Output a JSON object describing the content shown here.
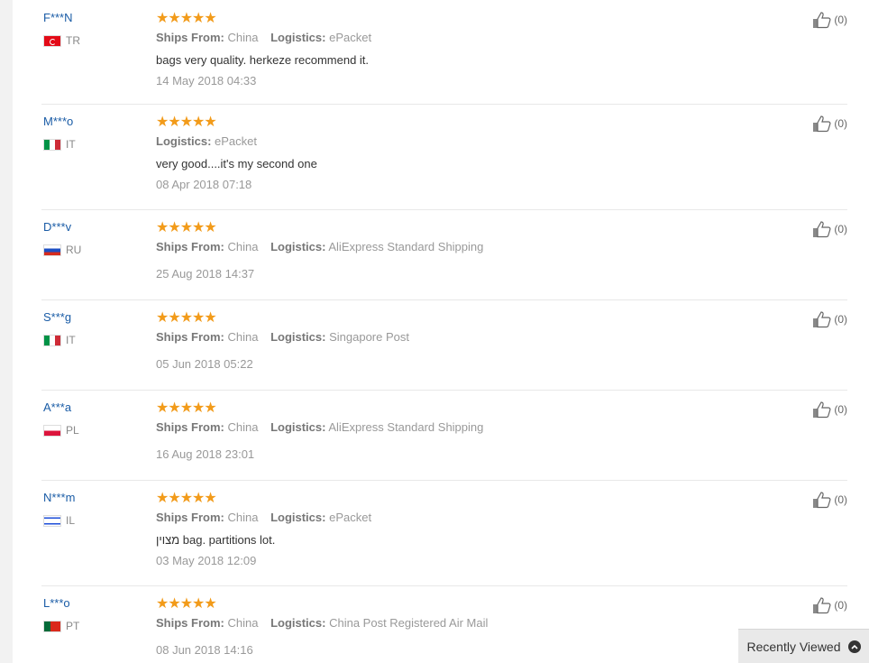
{
  "reviews": [
    {
      "user": "F***N",
      "country": "TR",
      "flag": "tr",
      "rating_stars": "★★★★★",
      "rating": 5,
      "ships_from_label": "Ships From:",
      "ships_from": "China",
      "logistics_label": "Logistics:",
      "logistics": "ePacket",
      "comment": "bags very quality. herkeze recommend it.",
      "date": "14 May 2018 04:33",
      "helpful": "(0)"
    },
    {
      "user": "M***o",
      "country": "IT",
      "flag": "it",
      "rating_stars": "★★★★★",
      "rating": 5,
      "ships_from_label": "",
      "ships_from": "",
      "logistics_label": "Logistics:",
      "logistics": "ePacket",
      "comment": "very good....it's my second one",
      "date": "08 Apr 2018 07:18",
      "helpful": "(0)"
    },
    {
      "user": "D***v",
      "country": "RU",
      "flag": "ru",
      "rating_stars": "★★★★★",
      "rating": 5,
      "ships_from_label": "Ships From:",
      "ships_from": "China",
      "logistics_label": "Logistics:",
      "logistics": "AliExpress Standard Shipping",
      "comment": "",
      "date": "25 Aug 2018 14:37",
      "helpful": "(0)"
    },
    {
      "user": "S***g",
      "country": "IT",
      "flag": "it",
      "rating_stars": "★★★★★",
      "rating": 5,
      "ships_from_label": "Ships From:",
      "ships_from": "China",
      "logistics_label": "Logistics:",
      "logistics": "Singapore Post",
      "comment": "",
      "date": "05 Jun 2018 05:22",
      "helpful": "(0)"
    },
    {
      "user": "A***a",
      "country": "PL",
      "flag": "pl",
      "rating_stars": "★★★★★",
      "rating": 5,
      "ships_from_label": "Ships From:",
      "ships_from": "China",
      "logistics_label": "Logistics:",
      "logistics": "AliExpress Standard Shipping",
      "comment": "",
      "date": "16 Aug 2018 23:01",
      "helpful": "(0)"
    },
    {
      "user": "N***m",
      "country": "IL",
      "flag": "il",
      "rating_stars": "★★★★★",
      "rating": 5,
      "ships_from_label": "Ships From:",
      "ships_from": "China",
      "logistics_label": "Logistics:",
      "logistics": "ePacket",
      "comment": "מצוין bag. partitions lot.",
      "date": "03 May 2018 12:09",
      "helpful": "(0)"
    },
    {
      "user": "L***o",
      "country": "PT",
      "flag": "pt",
      "rating_stars": "★★★★★",
      "rating": 5,
      "ships_from_label": "Ships From:",
      "ships_from": "China",
      "logistics_label": "Logistics:",
      "logistics": "China Post Registered Air Mail",
      "comment": "",
      "date": "08 Jun 2018 14:16",
      "helpful": "(0)"
    }
  ],
  "recently_viewed": {
    "label": "Recently Viewed",
    "icon": "chevron-up-icon"
  },
  "colors": {
    "star": "#f29b1a",
    "username": "#1a5ca6",
    "meta_text": "#999999"
  }
}
